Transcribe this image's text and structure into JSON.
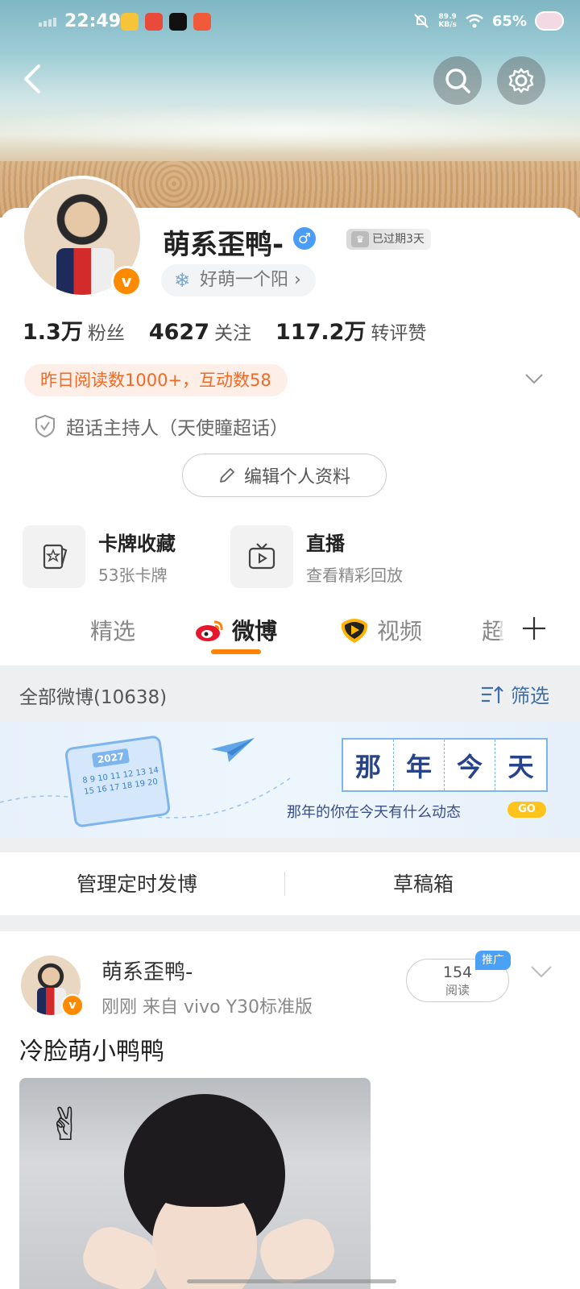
{
  "status_bar": {
    "time": "22:49",
    "net_speed_value": "89.9",
    "net_speed_unit": "KB/s",
    "battery": "65%"
  },
  "profile": {
    "username": "萌系歪鸭-",
    "gender_symbol": "♂",
    "vip_tag": "已过期3天",
    "group_pill": "好萌一个阳 ›",
    "badge_letter": "v",
    "stats": [
      {
        "value": "1.3万",
        "label": "粉丝"
      },
      {
        "value": "4627",
        "label": "关注"
      },
      {
        "value": "117.2万",
        "label": "转评赞"
      }
    ],
    "reads_pill": "昨日阅读数1000+，互动数58",
    "host_text": "超话主持人（天使瞳超话）",
    "edit_button": "编辑个人资料"
  },
  "features": [
    {
      "title": "卡牌收藏",
      "subtitle": "53张卡牌",
      "icon": "card-icon"
    },
    {
      "title": "直播",
      "subtitle": "查看精彩回放",
      "icon": "tv-icon"
    }
  ],
  "tabs": [
    {
      "label": "精选",
      "icon": ""
    },
    {
      "label": "微博",
      "icon": "weibo-icon"
    },
    {
      "label": "视频",
      "icon": "video-icon"
    },
    {
      "label": "超",
      "icon": ""
    }
  ],
  "filter_bar": {
    "all_label": "全部微博(10638)",
    "filter_label": "筛选"
  },
  "memory_banner": {
    "calendar_year": "2027",
    "calendar_days": "8 9 10 11 12 13 14 15 16 17 18 19 20",
    "title_chars": [
      "那",
      "年",
      "今",
      "天"
    ],
    "subtitle": "那年的你在今天有什么动态",
    "go_label": "GO"
  },
  "actions": {
    "scheduled": "管理定时发博",
    "drafts": "草稿箱"
  },
  "post": {
    "author": "萌系歪鸭-",
    "meta": "刚刚  来自 vivo Y30标准版",
    "reads_count": "154",
    "reads_label": "阅读",
    "promo_tag": "推广",
    "text": "冷脸萌小鸭鸭",
    "emoji": "✌"
  },
  "colors": {
    "accent_orange": "#ff8200",
    "link_blue": "#3f6fa8",
    "verified_orange": "#ff8a00"
  }
}
